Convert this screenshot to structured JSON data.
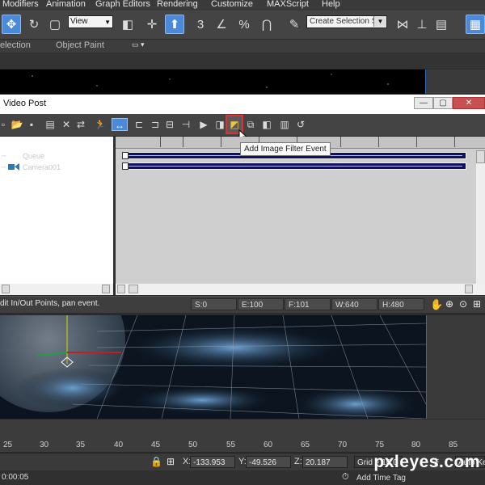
{
  "menu": [
    "Modifiers",
    "Animation",
    "Graph Editors",
    "Rendering",
    "Customize",
    "MAXScript",
    "Help"
  ],
  "toolbar": {
    "view_select": "View",
    "selection_set_placeholder": "Create Selection Se",
    "snap_labels": [
      "3",
      "%"
    ]
  },
  "ribbon": {
    "items": [
      "election",
      "Object Paint"
    ]
  },
  "video_post": {
    "title": "Video Post",
    "queue_root": "Queue",
    "queue_child": "Camera001",
    "tooltip": "Add Image Filter Event",
    "status_message": "dit In/Out Points, pan event.",
    "S": "S:0",
    "E": "E:100",
    "F": "F:101",
    "W": "W:640",
    "H": "H:480"
  },
  "timeline": {
    "ticks": [
      "25",
      "30",
      "35",
      "40",
      "45",
      "50",
      "55",
      "60",
      "65",
      "70",
      "75",
      "80",
      "85"
    ]
  },
  "status": {
    "x_label": "X:",
    "x": "-133.953",
    "y_label": "Y:",
    "y": "-49.526",
    "z_label": "Z:",
    "z": "20.187",
    "grid": "Grid = 10.0",
    "auto_key": "Auto Ke",
    "time": "0:00:05",
    "add_time_tag": "Add Time Tag"
  },
  "watermark": "pxleyes.com",
  "colors": {
    "accent": "#4a8ad8",
    "highlight": "#e03030",
    "track": "#101060"
  }
}
